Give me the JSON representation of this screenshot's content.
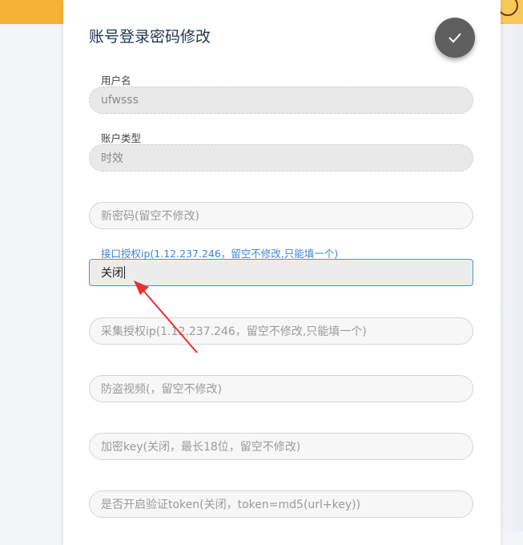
{
  "form": {
    "title": "账号登录密码修改",
    "submit_icon": "checkmark-icon",
    "username_label": "用户名",
    "username_value": "ufwsss",
    "account_type_label": "账户类型",
    "account_type_value": "时效",
    "new_password_placeholder": "新密码(留空不修改)",
    "api_ip_label": "接口授权ip(1.12.237.246，留空不修改,只能填一个)",
    "api_ip_value": "关闭",
    "collect_ip_placeholder": "采集授权ip(1.12.237.246，留空不修改,只能填一个)",
    "anti_leech_placeholder": "防盗视频(，留空不修改)",
    "encrypt_key_placeholder": "加密key(关闭，最长18位，留空不修改)",
    "token_placeholder": "是否开启验证token(关闭，token=md5(url+key))"
  },
  "colors": {
    "accent": "#3d86d4",
    "banner": "#f5b335",
    "annotation_arrow": "#e8322a",
    "submit_button": "#5f5f5f"
  }
}
